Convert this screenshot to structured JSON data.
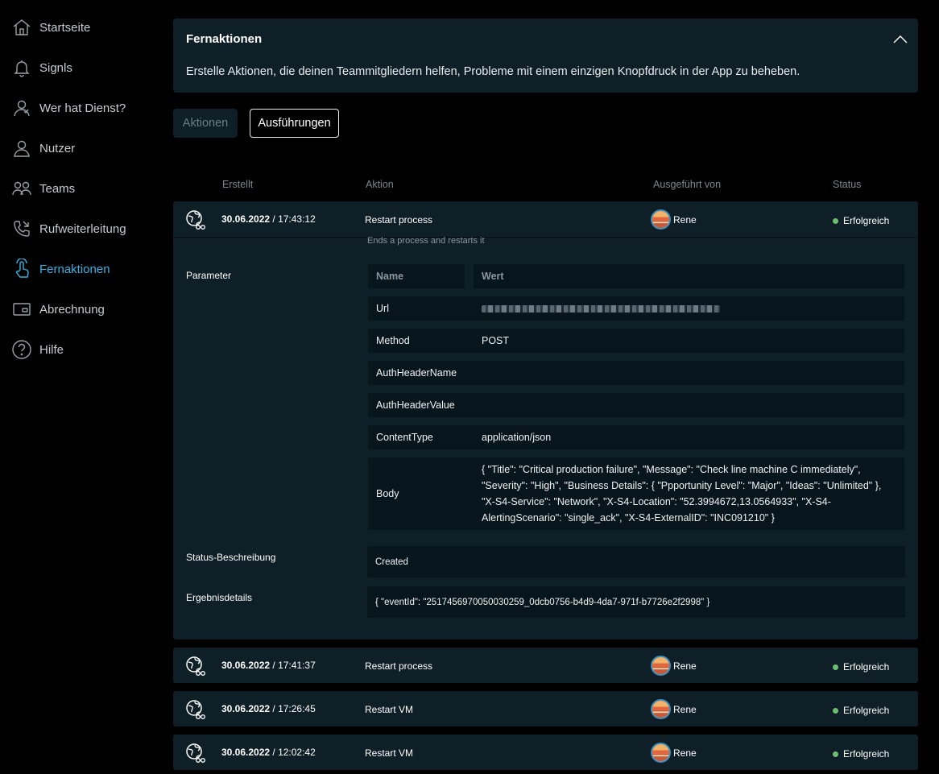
{
  "sidebar": {
    "items": [
      {
        "label": "Startseite",
        "icon": "home-icon"
      },
      {
        "label": "Signls",
        "icon": "bell-icon"
      },
      {
        "label": "Wer hat Dienst?",
        "icon": "on-duty-person-icon"
      },
      {
        "label": "Nutzer",
        "icon": "user-icon"
      },
      {
        "label": "Teams",
        "icon": "team-icon"
      },
      {
        "label": "Rufweiterleitung",
        "icon": "call-forward-icon"
      },
      {
        "label": "Fernaktionen",
        "icon": "remote-action-icon",
        "active": true
      },
      {
        "label": "Abrechnung",
        "icon": "billing-icon"
      },
      {
        "label": "Hilfe",
        "icon": "help-icon"
      }
    ]
  },
  "panel": {
    "title": "Fernaktionen",
    "description": "Erstelle Aktionen, die deinen Teammitgliedern helfen, Probleme mit einem einzigen Knopfdruck in der App zu beheben."
  },
  "tabs": {
    "aktionen": "Aktionen",
    "ausfuehrungen": "Ausführungen"
  },
  "table": {
    "headers": {
      "created": "Erstellt",
      "action": "Aktion",
      "executed_by": "Ausgeführt von",
      "status": "Status"
    },
    "rows": [
      {
        "date": "30.06.2022",
        "time": " / 17:43:12",
        "action": "Restart process",
        "user": "Rene",
        "status": "Erfolgreich"
      },
      {
        "date": "30.06.2022",
        "time": " / 17:41:37",
        "action": "Restart process",
        "user": "Rene",
        "status": "Erfolgreich"
      },
      {
        "date": "30.06.2022",
        "time": " / 17:26:45",
        "action": "Restart VM",
        "user": "Rene",
        "status": "Erfolgreich"
      },
      {
        "date": "30.06.2022",
        "time": " / 12:02:42",
        "action": "Restart VM",
        "user": "Rene",
        "status": "Erfolgreich"
      }
    ]
  },
  "detail": {
    "description": "Ends a process and restarts it",
    "parameter_label": "Parameter",
    "param_headers": {
      "name": "Name",
      "value": "Wert"
    },
    "params": [
      {
        "name": "Url",
        "value": ""
      },
      {
        "name": "Method",
        "value": "POST"
      },
      {
        "name": "AuthHeaderName",
        "value": ""
      },
      {
        "name": "AuthHeaderValue",
        "value": ""
      },
      {
        "name": "ContentType",
        "value": "application/json"
      },
      {
        "name": "Body",
        "value": "{ \"Title\": \"Critical production failure\", \"Message\": \"Check line machine C immediately\", \"Severity\": \"High\", \"Business Details\": { \"Ppportunity Level\": \"Major\", \"Ideas\": \"Unlimited\" }, \"X-S4-Service\": \"Network\", \"X-S4-Location\": \"52.3994672,13.0564933\", \"X-S4-AlertingScenario\": \"single_ack\", \"X-S4-ExternalID\": \"INC091210\" }"
      }
    ],
    "status_desc_label": "Status-Beschreibung",
    "status_desc_value": "Created",
    "result_label": "Ergebnisdetails",
    "result_value": "{ \"eventId\": \"2517456970050030259_0dcb0756-b4d9-4da7-971f-b7726e2f2998\" }"
  },
  "colors": {
    "background": "#000000",
    "panel": "#0f1f27",
    "cell": "#07151c",
    "accent": "#35b3e6",
    "success": "#6fbf73"
  }
}
